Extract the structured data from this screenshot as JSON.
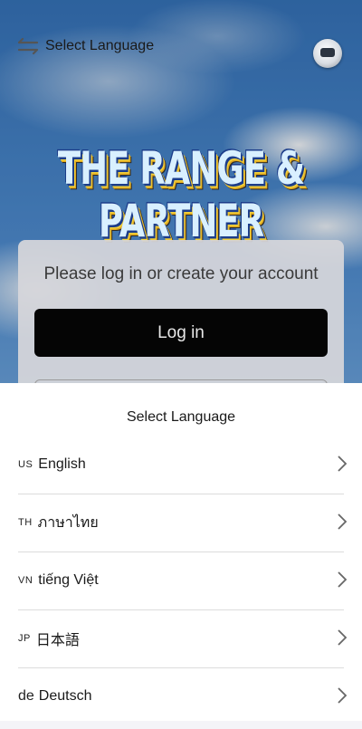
{
  "header": {
    "title": "Select Language"
  },
  "logo": {
    "text": "THE RANGE & PARTNER"
  },
  "login_card": {
    "prompt": "Please log in or create your account",
    "login_label": "Log in"
  },
  "language_sheet": {
    "title": "Select Language",
    "items": [
      {
        "code": "US",
        "label": "English"
      },
      {
        "code": "TH",
        "label": "ภาษาไทย"
      },
      {
        "code": "VN",
        "label": "tiếng Việt"
      },
      {
        "code": "JP",
        "label": "日本語"
      },
      {
        "code": "de",
        "label": "Deutsch"
      }
    ]
  },
  "icons": {
    "header_left": "swap-arrows-icon",
    "header_right": "avatar-icon",
    "row_action": "chevron-right-icon"
  },
  "colors": {
    "login_button": "#050505",
    "sheet_background": "#ffffff",
    "divider": "#dcdcdc"
  }
}
